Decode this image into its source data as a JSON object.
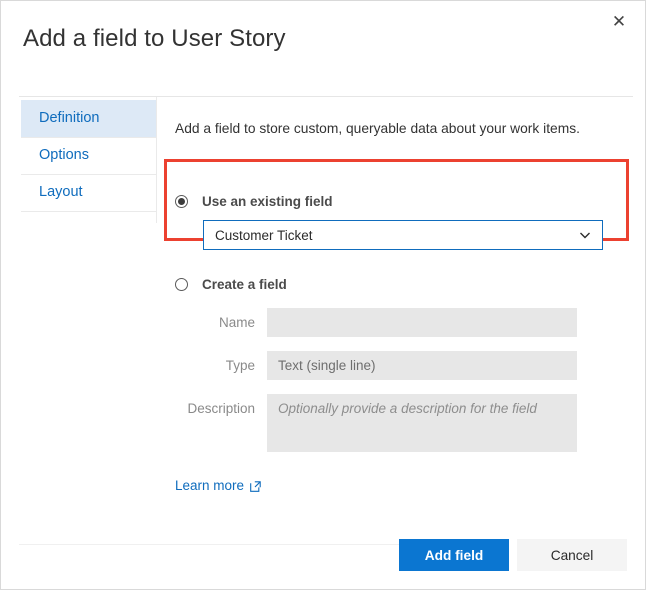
{
  "dialog": {
    "title": "Add a field to User Story",
    "close_icon": "close-icon",
    "close_label": "✕"
  },
  "tabs": [
    {
      "label": "Definition",
      "selected": true
    },
    {
      "label": "Options",
      "selected": false
    },
    {
      "label": "Layout",
      "selected": false
    }
  ],
  "main": {
    "intro": "Add a field to store custom, queryable data about your work items.",
    "existing": {
      "radio_label": "Use an existing field",
      "selected": true,
      "dropdown_value": "Customer Ticket",
      "dropdown_icon": "chevron-down-icon"
    },
    "create": {
      "radio_label": "Create a field",
      "selected": false,
      "fields": [
        {
          "label": "Name",
          "value": "",
          "placeholder": "",
          "disabled": true
        },
        {
          "label": "Type",
          "value": "Text (single line)",
          "placeholder": "",
          "disabled": true
        },
        {
          "label": "Description",
          "value": "",
          "placeholder": "Optionally provide a description for the field",
          "disabled": true
        }
      ]
    },
    "learn_more": {
      "label": "Learn more",
      "icon": "external-link-icon"
    }
  },
  "footer": {
    "primary_label": "Add field",
    "secondary_label": "Cancel"
  },
  "annotation": {
    "type": "highlight-rectangle",
    "color": "#ec4130",
    "target": "use-an-existing-field-section"
  },
  "colors": {
    "accent_blue": "#0b76d1",
    "link_blue": "#0f6cbd",
    "tab_selected_bg": "#dde9f6",
    "annotation_red": "#ec4130",
    "disabled_field_bg": "#e7e7e7"
  }
}
